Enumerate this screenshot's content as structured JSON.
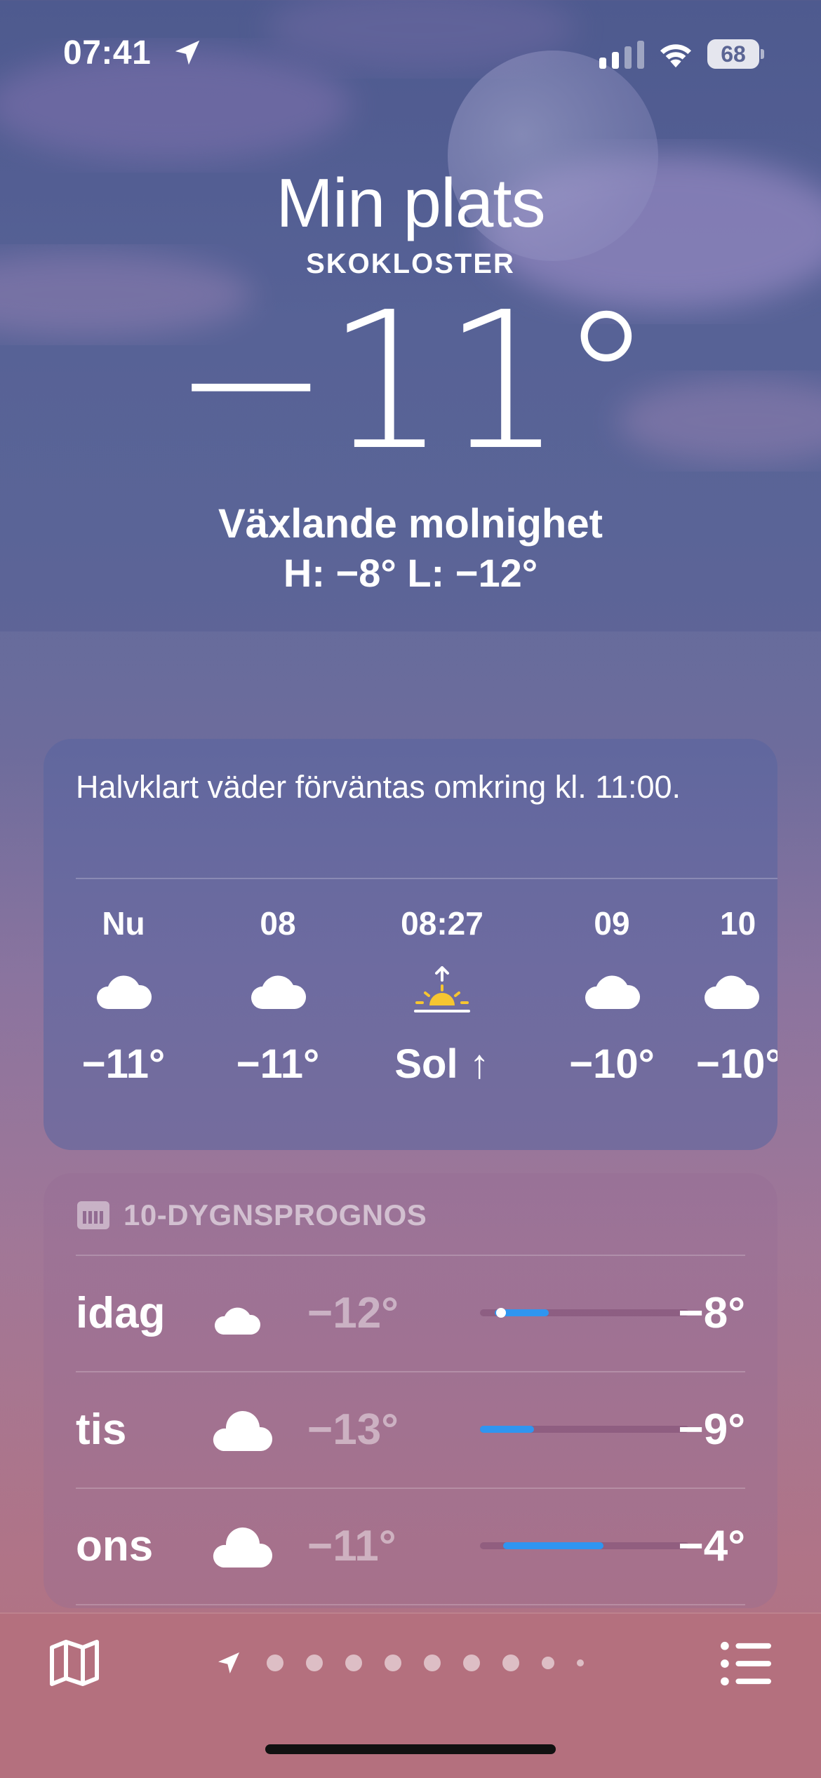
{
  "status_bar": {
    "time": "07:41",
    "battery": "68"
  },
  "header": {
    "title": "Min plats",
    "city": "SKOKLOSTER",
    "temperature": "−11°",
    "condition": "Växlande molnighet",
    "high_low": "H: −8°  L: −12°"
  },
  "hourly": {
    "summary": "Halvklart väder förväntas omkring kl. 11:00.",
    "hours": [
      {
        "label": "Nu",
        "icon": "cloud-icon",
        "value": "−11°"
      },
      {
        "label": "08",
        "icon": "cloud-icon",
        "value": "−11°"
      },
      {
        "label": "08:27",
        "icon": "sunrise-icon",
        "value": "Sol ↑"
      },
      {
        "label": "09",
        "icon": "cloud-icon",
        "value": "−10°"
      },
      {
        "label": "10",
        "icon": "cloud-icon",
        "value": "−10°"
      }
    ]
  },
  "daily": {
    "header": "10-DYGNSPROGNOS",
    "days": [
      {
        "day": "idag",
        "icon": "cloud-moon-icon",
        "low": "−12°",
        "high": "−8°",
        "range_start": 0.07,
        "range_end": 0.33,
        "current": 0.1
      },
      {
        "day": "tis",
        "icon": "cloud-icon",
        "low": "−13°",
        "high": "−9°",
        "range_start": 0.0,
        "range_end": 0.26
      },
      {
        "day": "ons",
        "icon": "cloud-icon",
        "low": "−11°",
        "high": "−4°",
        "range_start": 0.11,
        "range_end": 0.59
      }
    ]
  },
  "toolbar": {
    "map": "map-icon",
    "list": "list-icon",
    "page_count": 9,
    "active_page": 0
  }
}
